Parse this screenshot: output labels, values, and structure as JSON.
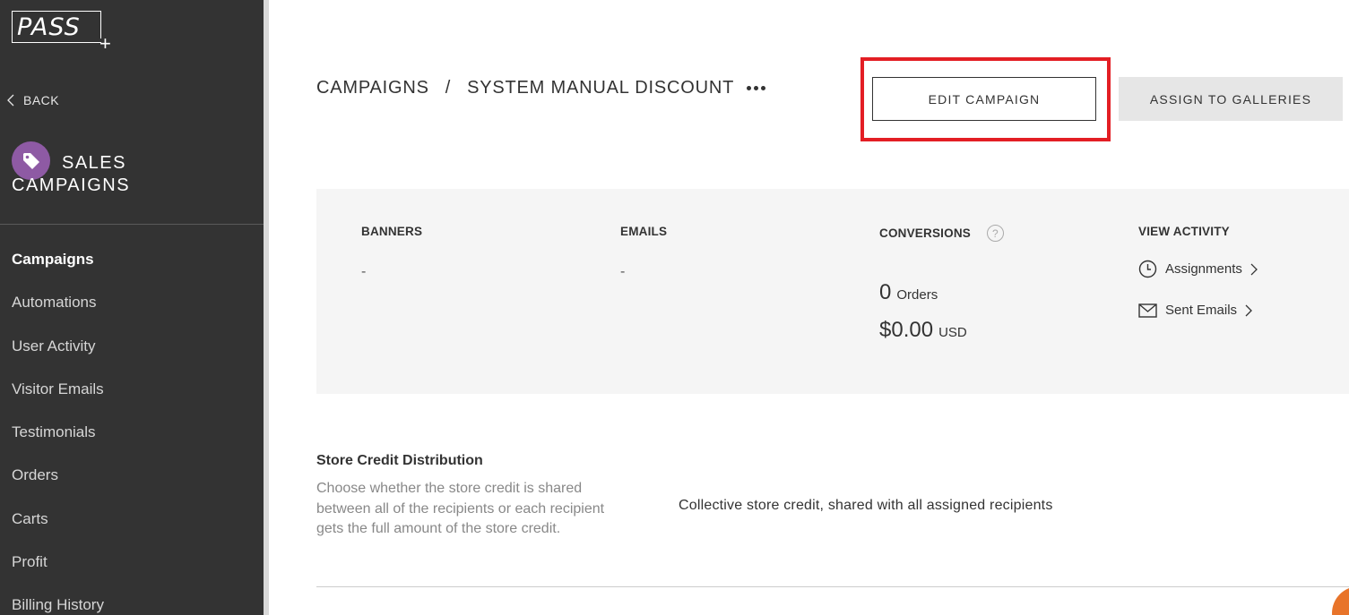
{
  "logo": {
    "text": "PASS",
    "plus": "+"
  },
  "sidebar": {
    "back_label": "BACK",
    "section_title_line1": "SALES",
    "section_title_line2": "CAMPAIGNS",
    "items": [
      {
        "label": "Campaigns",
        "active": true
      },
      {
        "label": "Automations"
      },
      {
        "label": "User Activity"
      },
      {
        "label": "Visitor Emails"
      },
      {
        "label": "Testimonials"
      },
      {
        "label": "Orders"
      },
      {
        "label": "Carts"
      },
      {
        "label": "Profit"
      },
      {
        "label": "Billing History"
      }
    ]
  },
  "breadcrumb": {
    "root": "CAMPAIGNS",
    "separator": "/",
    "current": "SYSTEM MANUAL DISCOUNT"
  },
  "actions": {
    "edit_label": "EDIT CAMPAIGN",
    "assign_label": "ASSIGN TO GALLERIES"
  },
  "stats": {
    "banners": {
      "label": "BANNERS",
      "value": "-"
    },
    "emails": {
      "label": "EMAILS",
      "value": "-"
    },
    "conversions": {
      "label": "CONVERSIONS",
      "help": "?",
      "orders_value": "0",
      "orders_unit": "Orders",
      "revenue_value": "$0.00",
      "revenue_unit": "USD"
    },
    "activity": {
      "label": "VIEW ACTIVITY",
      "assignments_label": "Assignments",
      "sent_emails_label": "Sent Emails"
    }
  },
  "store_credit": {
    "title": "Store Credit Distribution",
    "description": "Choose whether the store credit is shared between all of the recipients or each recipient gets the full amount of the store credit.",
    "value": "Collective store credit, shared with all assigned recipients"
  },
  "colors": {
    "sidebar_bg": "#333333",
    "tag_circle": "#8e5aa4",
    "highlight": "#e31e24",
    "stats_bg": "#f5f5f5"
  }
}
